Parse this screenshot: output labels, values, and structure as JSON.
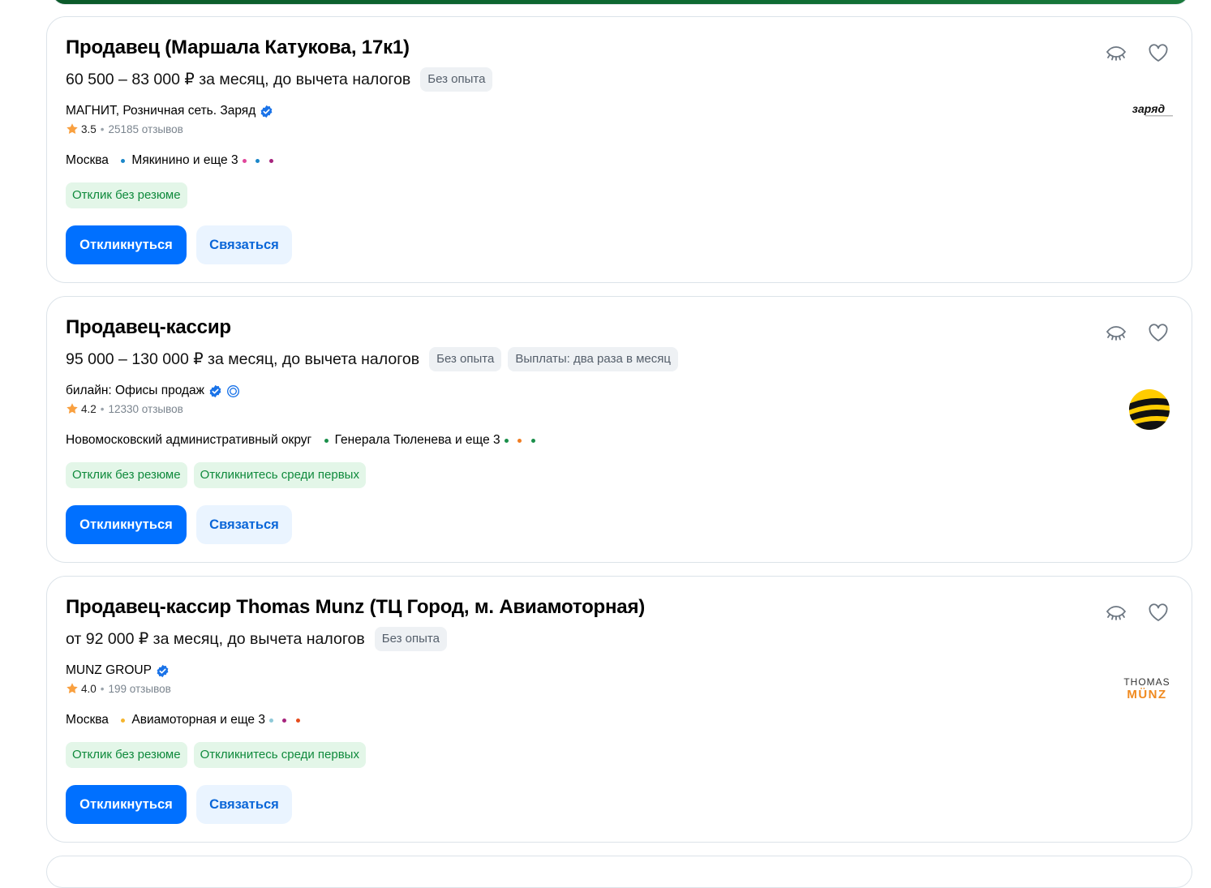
{
  "colors": {
    "accent": "#0070ff",
    "chip_green": "#0f8a3c",
    "star": "#f9a03f",
    "verified": "#1a73e8"
  },
  "buttons": {
    "respond_label": "Откликнуться",
    "contact_label": "Связаться"
  },
  "vacancies": [
    {
      "title": "Продавец (Маршала Катукова, 17к1)",
      "salary": "60 500 – 83 000 ₽ за месяц, до вычета налогов",
      "tags": [
        "Без опыта"
      ],
      "company": "МАГНИТ, Розничная сеть. Заряд",
      "rating": "3.5",
      "reviews": "25185 отзывов",
      "city": "Москва",
      "metro": "Мякинино и еще 3",
      "metro_dot_colors": [
        "#1b87c9",
        "#e0469a",
        "#1b87c9",
        "#a6247d"
      ],
      "chips": [
        "Отклик без резюме"
      ],
      "logo": "заряд"
    },
    {
      "title": "Продавец-кассир",
      "salary": "95 000 – 130 000 ₽ за месяц, до вычета налогов",
      "tags": [
        "Без опыта",
        "Выплаты: два раза в месяц"
      ],
      "company": "билайн: Офисы продаж",
      "rating": "4.2",
      "reviews": "12330 отзывов",
      "city": "Новомосковский административный округ",
      "metro": "Генерала Тюленева и еще 3",
      "metro_dot_colors": [
        "#1a8f4a",
        "#1a8f4a",
        "#f07d22",
        "#1a8f4a"
      ],
      "chips": [
        "Отклик без резюме",
        "Откликнитесь среди первых"
      ],
      "logo": "beeline"
    },
    {
      "title": "Продавец-кассир Thomas Munz (ТЦ Город, м. Авиамоторная)",
      "salary": "от 92 000 ₽ за месяц, до вычета налогов",
      "tags": [
        "Без опыта"
      ],
      "company": "MUNZ GROUP",
      "rating": "4.0",
      "reviews": "199 отзывов",
      "city": "Москва",
      "metro": "Авиамоторная и еще 3",
      "metro_dot_colors": [
        "#f5b52e",
        "#8fc9d8",
        "#a6247d",
        "#e54b1c"
      ],
      "chips": [
        "Отклик без резюме",
        "Откликнитесь среди первых"
      ],
      "logo_top": "THOMAS",
      "logo_bottom": "MÜNZ"
    }
  ]
}
